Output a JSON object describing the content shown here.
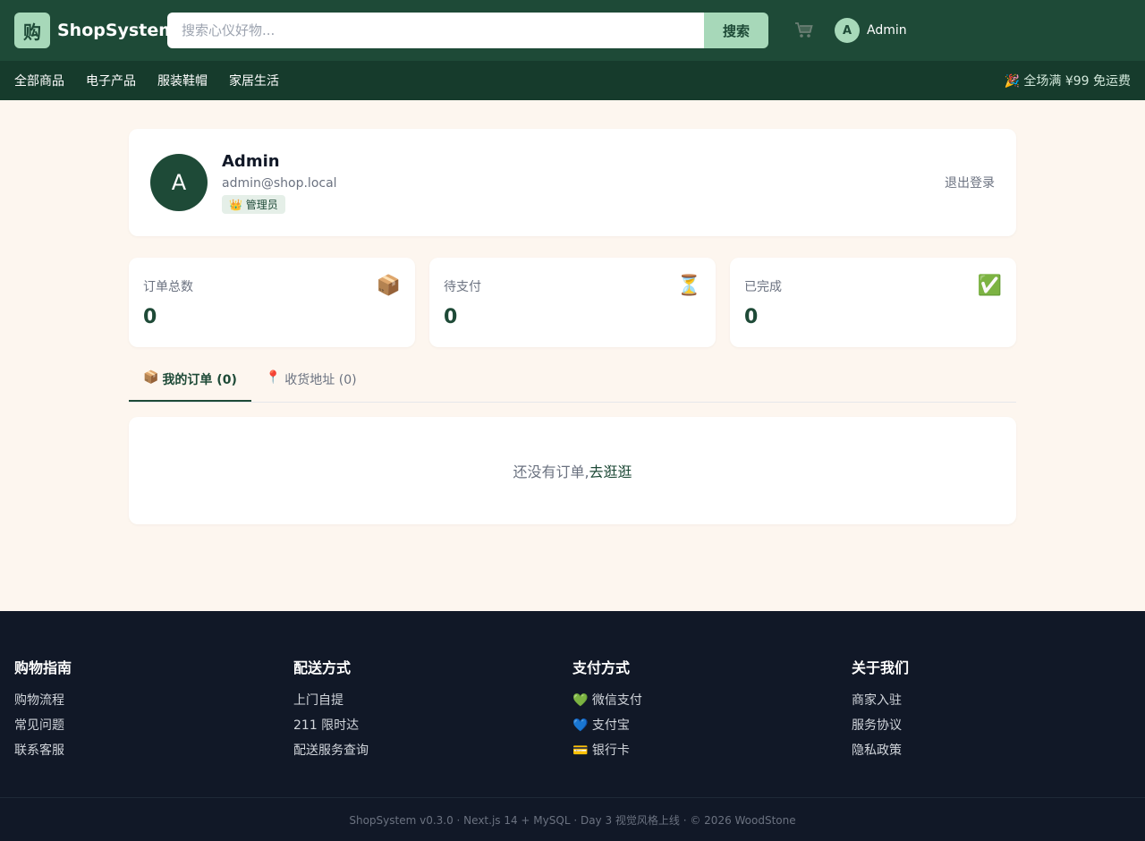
{
  "header": {
    "logo_char": "购",
    "brand": "ShopSystem",
    "search_placeholder": "搜索心仪好物...",
    "search_button": "搜索",
    "cart_icon": "shopping-cart-icon",
    "user_initial": "A",
    "user_name": "Admin"
  },
  "nav": {
    "items": [
      {
        "label": "全部商品"
      },
      {
        "label": "电子产品"
      },
      {
        "label": "服装鞋帽"
      },
      {
        "label": "家居生活"
      }
    ],
    "promo": "🎉 全场满 ¥99 免运费"
  },
  "profile": {
    "initial": "A",
    "name": "Admin",
    "email": "admin@shop.local",
    "role_badge": "👑 管理员",
    "logout": "退出登录"
  },
  "stats": [
    {
      "label": "订单总数",
      "value": "0",
      "icon": "📦"
    },
    {
      "label": "待支付",
      "value": "0",
      "icon": "⏳"
    },
    {
      "label": "已完成",
      "value": "0",
      "icon": "✅"
    }
  ],
  "tabs": [
    {
      "icon": "📦",
      "label": "我的订单 (0)",
      "active": true
    },
    {
      "icon": "📍",
      "label": "收货地址 (0)",
      "active": false
    }
  ],
  "empty": {
    "text": "还没有订单,",
    "link": "去逛逛"
  },
  "footer": {
    "columns": [
      {
        "title": "购物指南",
        "links": [
          "购物流程",
          "常见问题",
          "联系客服"
        ]
      },
      {
        "title": "配送方式",
        "links": [
          "上门自提",
          "211 限时达",
          "配送服务查询"
        ]
      },
      {
        "title": "支付方式",
        "links": [
          "💚 微信支付",
          "💙 支付宝",
          "💳 银行卡"
        ]
      },
      {
        "title": "关于我们",
        "links": [
          "商家入驻",
          "服务协议",
          "隐私政策"
        ]
      }
    ],
    "copyright": "ShopSystem v0.3.0 · Next.js 14 + MySQL · Day 3 视觉风格上线 · © 2026 WoodStone"
  }
}
